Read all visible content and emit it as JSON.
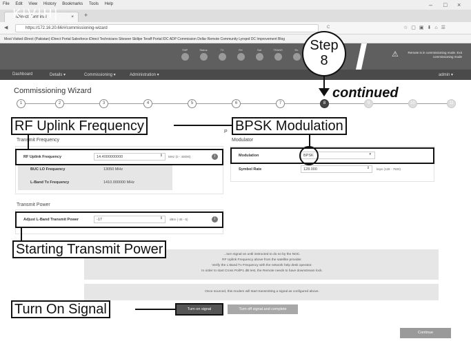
{
  "browser": {
    "menu": [
      "File",
      "Edit",
      "View",
      "History",
      "Bookmarks",
      "Tools",
      "Help"
    ],
    "window_controls": [
      "–",
      "□",
      "×"
    ],
    "tab_title": "iDirect Terminal",
    "new_tab": "+",
    "url": "https://172.16.20.66/#/commissioning-wizard",
    "bookmarks": "Most Visited   iDirect (Pakistan)   iDirect Portal   Salesforce   iDirect Technicians   Siteseer   Skillpe   Teraff Portal   IDC   ADP   Commission   Dollar   Remote Community   Lynqed   DC Improvement Blog"
  },
  "app": {
    "logo": "K|V|H|",
    "indicators": [
      "TMP",
      "Status",
      "TX",
      "RX",
      "Sat",
      "TRANS",
      "Rx",
      "Tx"
    ],
    "status_text": "Remote is in commissioning mode. Exit commissioning mode",
    "nav": {
      "dashboard": "Dashboard",
      "details": "Details ▾",
      "commissioning": "Commissioning ▾",
      "administration": "Administration ▾",
      "user": "admin ▾"
    }
  },
  "wizard": {
    "title": "Commissioning Wizard",
    "steps": [
      "1",
      "2",
      "3",
      "4",
      "5",
      "6",
      "7",
      "8",
      "9",
      "10",
      "11"
    ],
    "active_step_index": 7,
    "transmit_frequency_heading": "Transmit Frequency",
    "modulator_heading": "Modulator",
    "partial_heading": "P",
    "rf_uplink_label": "RF Uplink Frequency",
    "rf_uplink_value": "14.4000000000",
    "rf_uplink_unit": "MHz (0 - 40000)",
    "buc_lo_label": "BUC LO Frequency",
    "buc_lo_value": "13050  MHz",
    "lband_tx_label": "L-Band Tx Frequency",
    "lband_tx_value": "1410.000000  MHz",
    "modulation_label": "Modulation",
    "modulation_value": "BPSK",
    "symbol_rate_label": "Symbol Rate",
    "symbol_rate_value": "128.000",
    "symbol_rate_unit": "ksps (128 - 7500)",
    "transmit_power_heading": "Transmit Power",
    "adjust_power_label": "Adjust L-Band Transmit Power",
    "adjust_power_value": "-17",
    "adjust_power_unit": "dBm (-45 - 5)",
    "warning_lines": [
      "...turn signal on until instructed to do so by the NOC.",
      "RF Uplink Frequency above from the satellite provider.",
      "Verify the L-Band Tx Frequency with the network help desk operator.",
      "In order to start Cross Pol/P1 dB test, the Remote needs to have downstream lock."
    ],
    "once_sourced": "Once sourced, this modem will start transmitting a signal as configured above.",
    "turn_on_button": "Turn on signal",
    "turn_off_button": "Turn off signal and complete",
    "continue_button": "Continue"
  },
  "callouts": {
    "step_word": "Step",
    "step_number": "8",
    "continued": "continued",
    "rf_uplink": "RF Uplink Frequency",
    "bpsk": "BPSK Modulation",
    "starting_power": "Starting Transmit Power",
    "turn_on": "Turn On Signal"
  },
  "colors": {
    "header": "#5f5f5f",
    "nav": "#4a4a4a",
    "button_dark": "#555555",
    "button_light": "#a8a8a8",
    "gray_panel": "#e6e6e6"
  }
}
